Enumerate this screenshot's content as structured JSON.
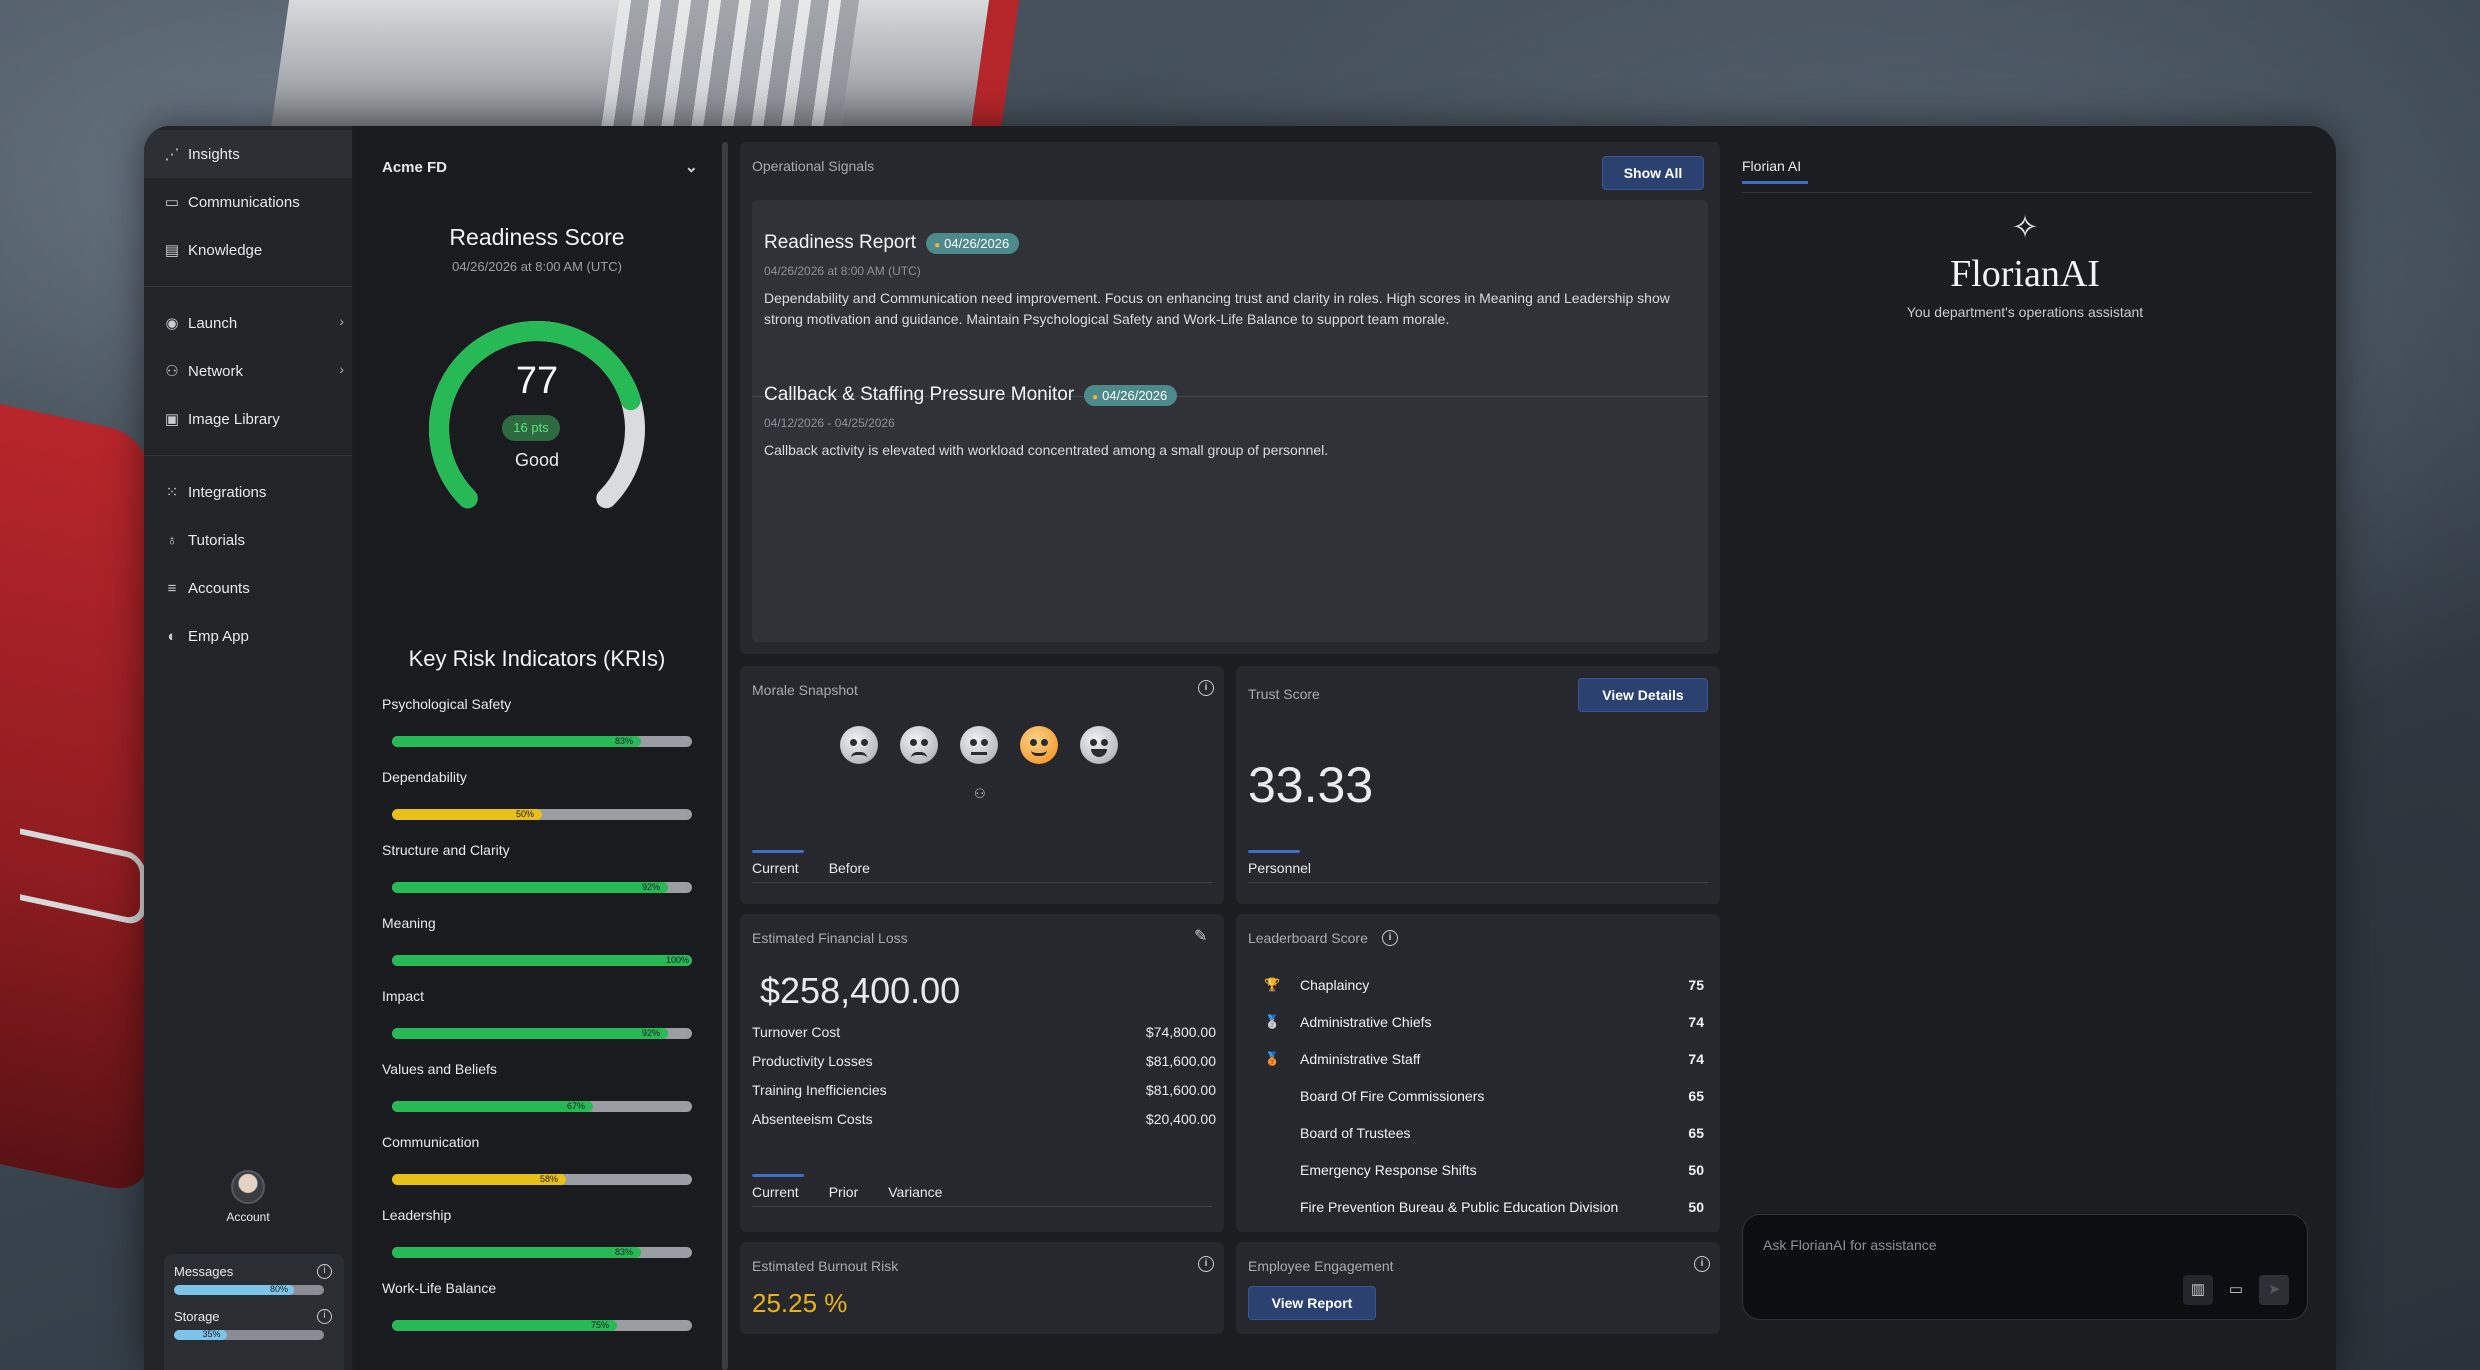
{
  "sidebar": {
    "items": [
      {
        "label": "Insights",
        "icon": "insights-icon",
        "glyph": "⋰",
        "active": true
      },
      {
        "label": "Communications",
        "icon": "chat-icon",
        "glyph": "▭"
      },
      {
        "label": "Knowledge",
        "icon": "book-icon",
        "glyph": "▤"
      },
      {
        "label": "Launch",
        "icon": "target-icon",
        "glyph": "◉"
      },
      {
        "label": "Network",
        "icon": "network-icon",
        "glyph": "⚇"
      },
      {
        "label": "Image Library",
        "icon": "image-icon",
        "glyph": "▣"
      },
      {
        "label": "Integrations",
        "icon": "grid-icon",
        "glyph": "⁙"
      },
      {
        "label": "Tutorials",
        "icon": "lightbulb-icon",
        "glyph": "♁"
      },
      {
        "label": "Accounts",
        "icon": "list-icon",
        "glyph": "≡"
      },
      {
        "label": "Emp App",
        "icon": "contrast-icon",
        "glyph": "◐"
      }
    ],
    "account_label": "Account",
    "usage": [
      {
        "label": "Messages",
        "percent": 80,
        "percent_label": "80%"
      },
      {
        "label": "Storage",
        "percent": 35,
        "percent_label": "35%"
      }
    ]
  },
  "readiness": {
    "org": "Acme FD",
    "title": "Readiness Score",
    "date": "04/26/2026 at 8:00 AM (UTC)",
    "score": "77",
    "score_value": 77,
    "badge": "16 pts",
    "label": "Good",
    "kri_title": "Key Risk Indicators (KRIs)",
    "kris": [
      {
        "name": "Psychological Safety",
        "percent": 83,
        "percent_label": "83%",
        "color": "green"
      },
      {
        "name": "Dependability",
        "percent": 50,
        "percent_label": "50%",
        "color": "yellow"
      },
      {
        "name": "Structure and Clarity",
        "percent": 92,
        "percent_label": "92%",
        "color": "green"
      },
      {
        "name": "Meaning",
        "percent": 100,
        "percent_label": "100%",
        "color": "green"
      },
      {
        "name": "Impact",
        "percent": 92,
        "percent_label": "92%",
        "color": "green"
      },
      {
        "name": "Values and Beliefs",
        "percent": 67,
        "percent_label": "67%",
        "color": "green"
      },
      {
        "name": "Communication",
        "percent": 58,
        "percent_label": "58%",
        "color": "yellow"
      },
      {
        "name": "Leadership",
        "percent": 83,
        "percent_label": "83%",
        "color": "green"
      },
      {
        "name": "Work-Life Balance",
        "percent": 75,
        "percent_label": "75%",
        "color": "green"
      }
    ]
  },
  "signals": {
    "title": "Operational Signals",
    "show_all": "Show All",
    "items": [
      {
        "title": "Readiness Report",
        "tag": "04/26/2026",
        "date": "04/26/2026 at 8:00 AM (UTC)",
        "desc": "Dependability and Communication need improvement. Focus on enhancing trust and clarity in roles. High scores in Meaning and Leadership show strong motivation and guidance. Maintain Psychological Safety and Work-Life Balance to support team morale."
      },
      {
        "title": "Callback & Staffing Pressure Monitor",
        "tag": "04/26/2026",
        "date": "04/12/2026 - 04/25/2026",
        "desc": "Callback activity is elevated with workload concentrated among a small group of personnel."
      }
    ]
  },
  "morale": {
    "title": "Morale Snapshot",
    "tabs": [
      "Current",
      "Before"
    ]
  },
  "trust": {
    "title": "Trust Score",
    "button": "View Details",
    "value": "33.33",
    "tabs": [
      "Personnel"
    ]
  },
  "financial": {
    "title": "Estimated Financial Loss",
    "total": "$258,400.00",
    "rows": [
      {
        "label": "Turnover Cost",
        "value": "$74,800.00"
      },
      {
        "label": "Productivity Losses",
        "value": "$81,600.00"
      },
      {
        "label": "Training Inefficiencies",
        "value": "$81,600.00"
      },
      {
        "label": "Absenteeism Costs",
        "value": "$20,400.00"
      }
    ],
    "tabs": [
      "Current",
      "Prior",
      "Variance"
    ]
  },
  "leaderboard": {
    "title": "Leaderboard Score",
    "rows": [
      {
        "name": "Chaplaincy",
        "score": "75",
        "medal": "🏆"
      },
      {
        "name": "Administrative Chiefs",
        "score": "74",
        "medal": "🥈"
      },
      {
        "name": "Administrative Staff",
        "score": "74",
        "medal": "🥉"
      },
      {
        "name": "Board Of Fire Commissioners",
        "score": "65",
        "medal": ""
      },
      {
        "name": "Board of Trustees",
        "score": "65",
        "medal": ""
      },
      {
        "name": "Emergency Response Shifts",
        "score": "50",
        "medal": ""
      },
      {
        "name": "Fire Prevention Bureau & Public Education Division",
        "score": "50",
        "medal": ""
      }
    ]
  },
  "burnout": {
    "title": "Estimated Burnout Risk",
    "value": "25.25 %"
  },
  "engagement": {
    "title": "Employee Engagement",
    "button": "View Report"
  },
  "ai": {
    "tab": "Florian AI",
    "brand": "FlorianAI",
    "subtitle": "You department's operations assistant",
    "placeholder": "Ask FlorianAI for assistance"
  }
}
